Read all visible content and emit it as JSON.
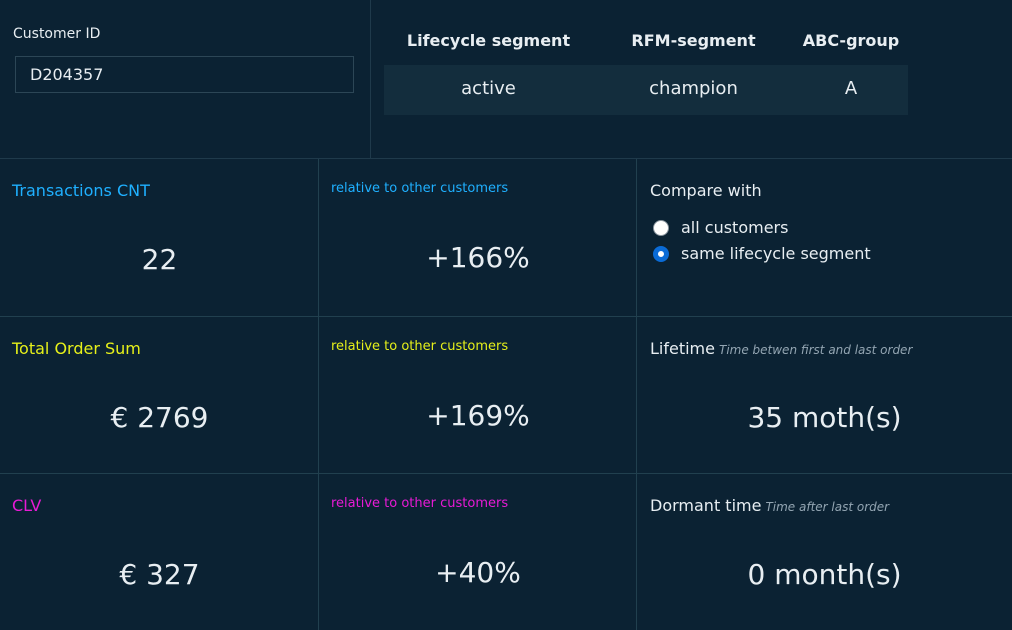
{
  "customer": {
    "label": "Customer ID",
    "id_value": "D204357"
  },
  "segments": {
    "headers": [
      "Lifecycle segment",
      "RFM-segment",
      "ABC-group"
    ],
    "values": [
      "active",
      "champion",
      "A"
    ]
  },
  "metrics": [
    {
      "title": "Transactions CNT",
      "value": "22",
      "relative_label": "relative to other customers",
      "relative_value": "+166%",
      "color": "#1fb0ff"
    },
    {
      "title": "Total Order Sum",
      "value": "€ 2769",
      "relative_label": "relative to other customers",
      "relative_value": "+169%",
      "color": "#e6f01a"
    },
    {
      "title": "CLV",
      "value": "€ 327",
      "relative_label": "relative to other customers",
      "relative_value": "+40%",
      "color": "#e81ad6"
    }
  ],
  "compare": {
    "title": "Compare with",
    "options": [
      {
        "label": "all customers",
        "selected": false
      },
      {
        "label": "same lifecycle segment",
        "selected": true
      }
    ]
  },
  "lifetime": {
    "title": "Lifetime",
    "subtitle": "Time betwen first and last order",
    "value": "35 moth(s)"
  },
  "dormant": {
    "title": "Dormant time",
    "subtitle": "Time after last order",
    "value": "0 month(s)"
  }
}
